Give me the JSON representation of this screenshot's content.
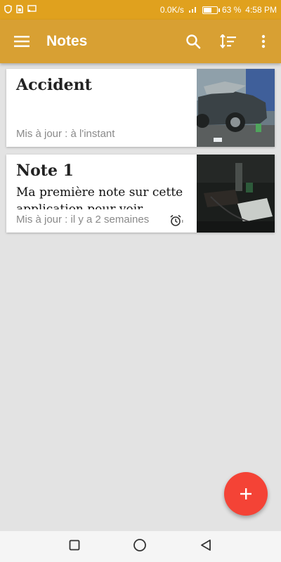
{
  "status_bar": {
    "speed": "0.0K/s",
    "battery": "63 %",
    "battery_level": 0.63,
    "time": "4:58 PM"
  },
  "app_bar": {
    "title": "Notes",
    "background": "#d8a033"
  },
  "notes": [
    {
      "title": "Accident",
      "body": "",
      "meta": "Mis à jour : à l'instant",
      "has_alarm": false,
      "thumbnail": "car-photo"
    },
    {
      "title": "Note 1",
      "body": "Ma première note sur cette application pour voir",
      "meta": "Mis à jour : il y a 2 semaines",
      "has_alarm": true,
      "thumbnail": "dark-room-photo"
    }
  ],
  "fab": {
    "icon": "plus-icon",
    "color": "#f44336"
  },
  "nav_bar": {
    "icons": [
      "recent-apps-icon",
      "home-icon",
      "back-icon"
    ]
  }
}
